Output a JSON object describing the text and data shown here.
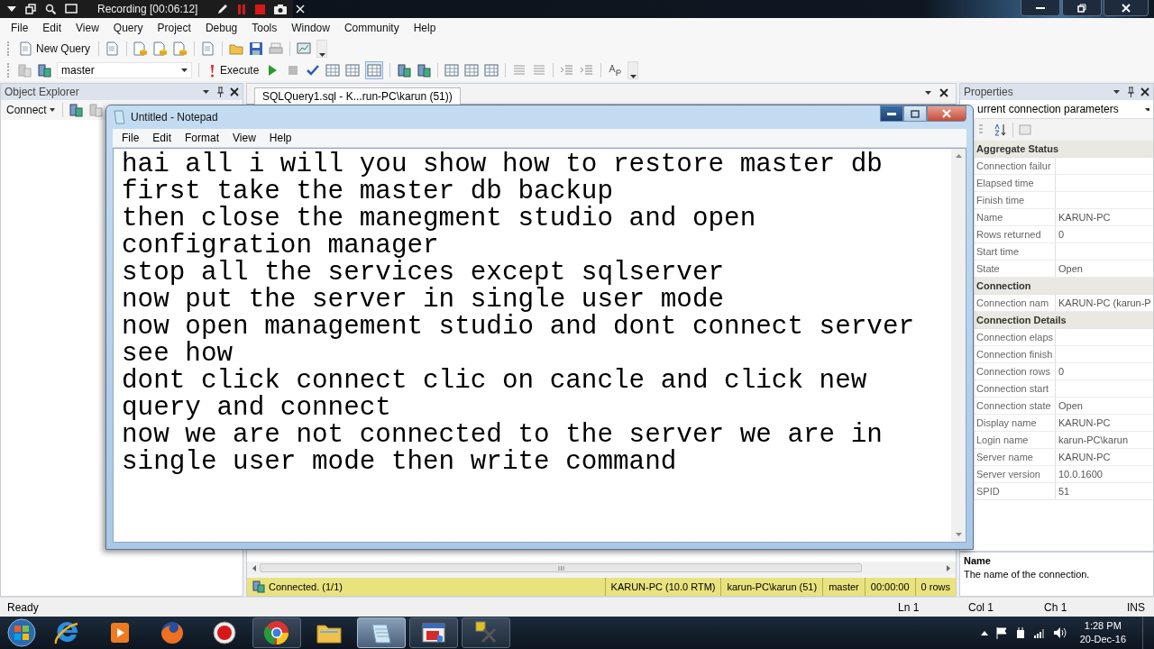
{
  "recorder": {
    "title": "Recording [00:06:12]"
  },
  "menu": [
    "File",
    "Edit",
    "View",
    "Query",
    "Project",
    "Debug",
    "Tools",
    "Window",
    "Community",
    "Help"
  ],
  "toolbar": {
    "new_query": "New Query",
    "database": "master",
    "execute": "Execute"
  },
  "object_explorer": {
    "title": "Object Explorer",
    "connect": "Connect"
  },
  "document": {
    "tab": "SQLQuery1.sql - K...run-PC\\karun (51))",
    "status": "Connected. (1/1)",
    "status_cells": [
      "KARUN-PC (10.0 RTM)",
      "karun-PC\\karun (51)",
      "master",
      "00:00:00",
      "0 rows"
    ]
  },
  "notepad": {
    "title": "Untitled - Notepad",
    "menu": [
      "File",
      "Edit",
      "Format",
      "View",
      "Help"
    ],
    "lines": [
      "hai all i will you show how to restore master db",
      "first take the master db backup",
      "then close the manegment studio and open",
      "configration manager",
      "stop all the services except sqlserver",
      "now put the server in single user mode",
      "now open management studio and dont connect server",
      "see how",
      "dont click connect clic on cancle and click new",
      "query and connect",
      "now we are not connected to the server we are in",
      "single user mode then write command"
    ]
  },
  "properties": {
    "title": "Properties",
    "object": "urrent connection parameters",
    "groups": [
      {
        "name": "Aggregate Status",
        "rows": [
          {
            "name": "Connection failur"
          },
          {
            "name": "Elapsed time"
          },
          {
            "name": "Finish time"
          },
          {
            "name": "Name",
            "value": "KARUN-PC"
          },
          {
            "name": "Rows returned",
            "value": "0"
          },
          {
            "name": "Start time"
          },
          {
            "name": "State",
            "value": "Open"
          }
        ]
      },
      {
        "name": "Connection",
        "rows": [
          {
            "name": "Connection nam",
            "value": "KARUN-PC (karun-P"
          }
        ]
      },
      {
        "name": "Connection Details",
        "rows": [
          {
            "name": "Connection elaps"
          },
          {
            "name": "Connection finish"
          },
          {
            "name": "Connection rows",
            "value": "0"
          },
          {
            "name": "Connection start"
          },
          {
            "name": "Connection state",
            "value": "Open"
          },
          {
            "name": "Display name",
            "value": "KARUN-PC"
          },
          {
            "name": "Login name",
            "value": "karun-PC\\karun"
          },
          {
            "name": "Server name",
            "value": "KARUN-PC"
          },
          {
            "name": "Server version",
            "value": "10.0.1600"
          },
          {
            "name": "SPID",
            "value": "51"
          }
        ]
      }
    ],
    "description": {
      "title": "Name",
      "text": "The name of the connection."
    }
  },
  "status_bar": {
    "text": "Ready",
    "cells": [
      "Ln 1",
      "Col 1",
      "Ch 1",
      "INS"
    ]
  },
  "taskbar": {
    "apps": [
      {
        "kind": "ie",
        "running": false,
        "selected": false
      },
      {
        "kind": "media",
        "running": false,
        "selected": false
      },
      {
        "kind": "firefox",
        "running": false,
        "selected": false
      },
      {
        "kind": "recorder",
        "running": false,
        "selected": false
      },
      {
        "kind": "chrome",
        "running": true,
        "selected": false
      },
      {
        "kind": "folder",
        "running": false,
        "selected": false
      },
      {
        "kind": "notepad",
        "running": true,
        "selected": true
      },
      {
        "kind": "toolbox",
        "running": true,
        "selected": false
      },
      {
        "kind": "tools",
        "running": true,
        "selected": false
      }
    ],
    "time": "1:28 PM",
    "date": "20-Dec-16"
  }
}
